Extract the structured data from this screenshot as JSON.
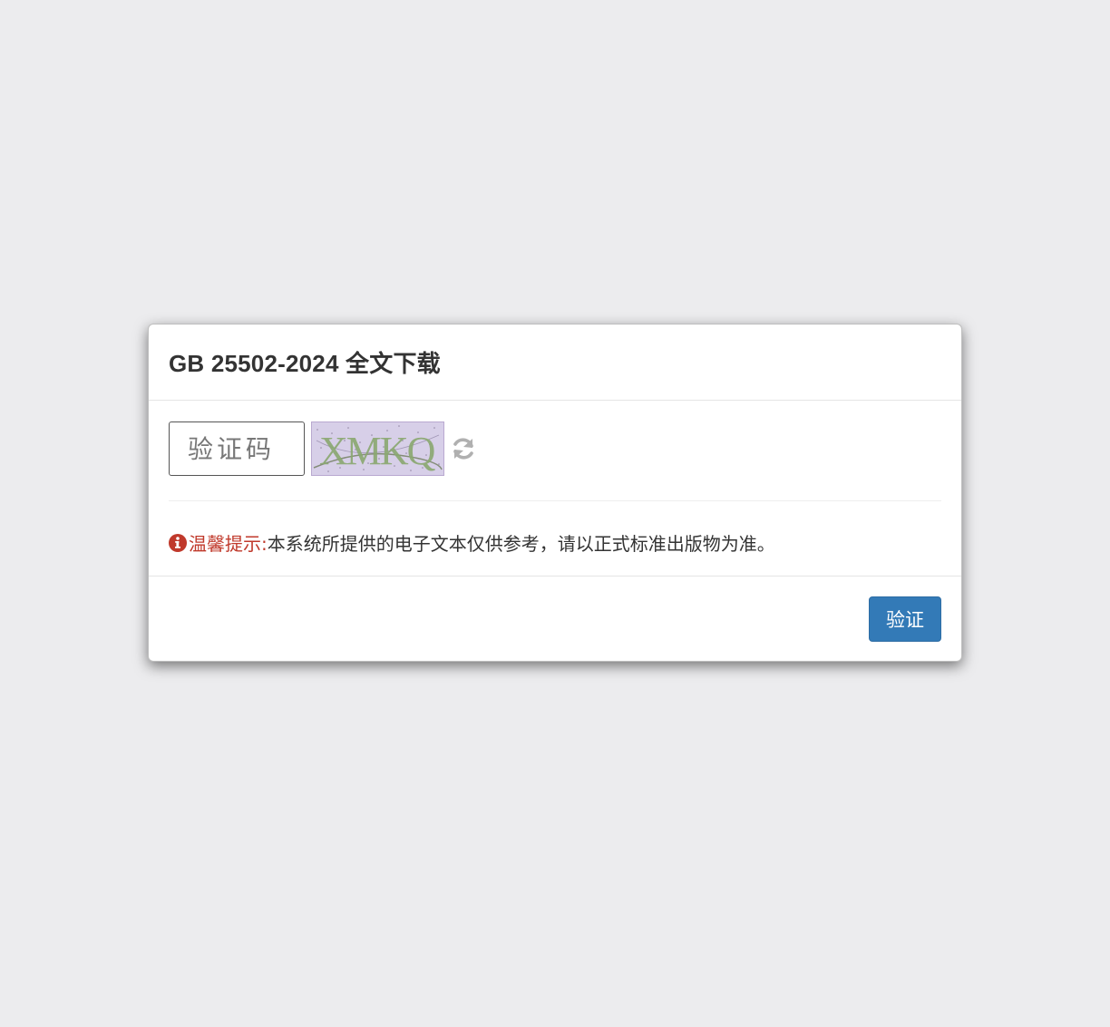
{
  "modal": {
    "title": "GB 25502-2024 全文下载"
  },
  "captcha": {
    "placeholder": "验证码",
    "value": "",
    "image_text": "XMKQ",
    "refresh_icon": "refresh-icon"
  },
  "notice": {
    "icon": "info-circle-icon",
    "label": "温馨提示:",
    "text": "本系统所提供的电子文本仅供参考，请以正式标准出版物为准。"
  },
  "footer": {
    "verify_label": "验证"
  },
  "colors": {
    "page_background": "#ececee",
    "primary_button": "#337ab7",
    "notice_label": "#c0392b",
    "captcha_background": "#d7cfe8",
    "captcha_text": "#8aa870"
  }
}
